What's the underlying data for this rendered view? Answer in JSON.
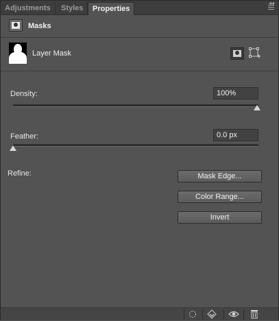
{
  "tabs": [
    {
      "label": "Adjustments",
      "active": false
    },
    {
      "label": "Styles",
      "active": false
    },
    {
      "label": "Properties",
      "active": true
    }
  ],
  "header": {
    "title": "Masks"
  },
  "layer": {
    "label": "Layer Mask"
  },
  "density": {
    "label": "Density:",
    "value": "100%",
    "level_percent": 100
  },
  "feather": {
    "label": "Feather:",
    "value": "0.0 px",
    "level_percent": 0
  },
  "refine": {
    "label": "Refine:",
    "buttons": [
      "Mask Edge...",
      "Color Range...",
      "Invert"
    ]
  },
  "footer": {
    "icons": [
      "load-selection-icon",
      "apply-mask-icon",
      "visibility-icon",
      "trash-icon"
    ]
  },
  "colors": {
    "panel_bg": "#535353",
    "tabbar_bg": "#3d3d3d",
    "text": "#e6e6e6"
  }
}
